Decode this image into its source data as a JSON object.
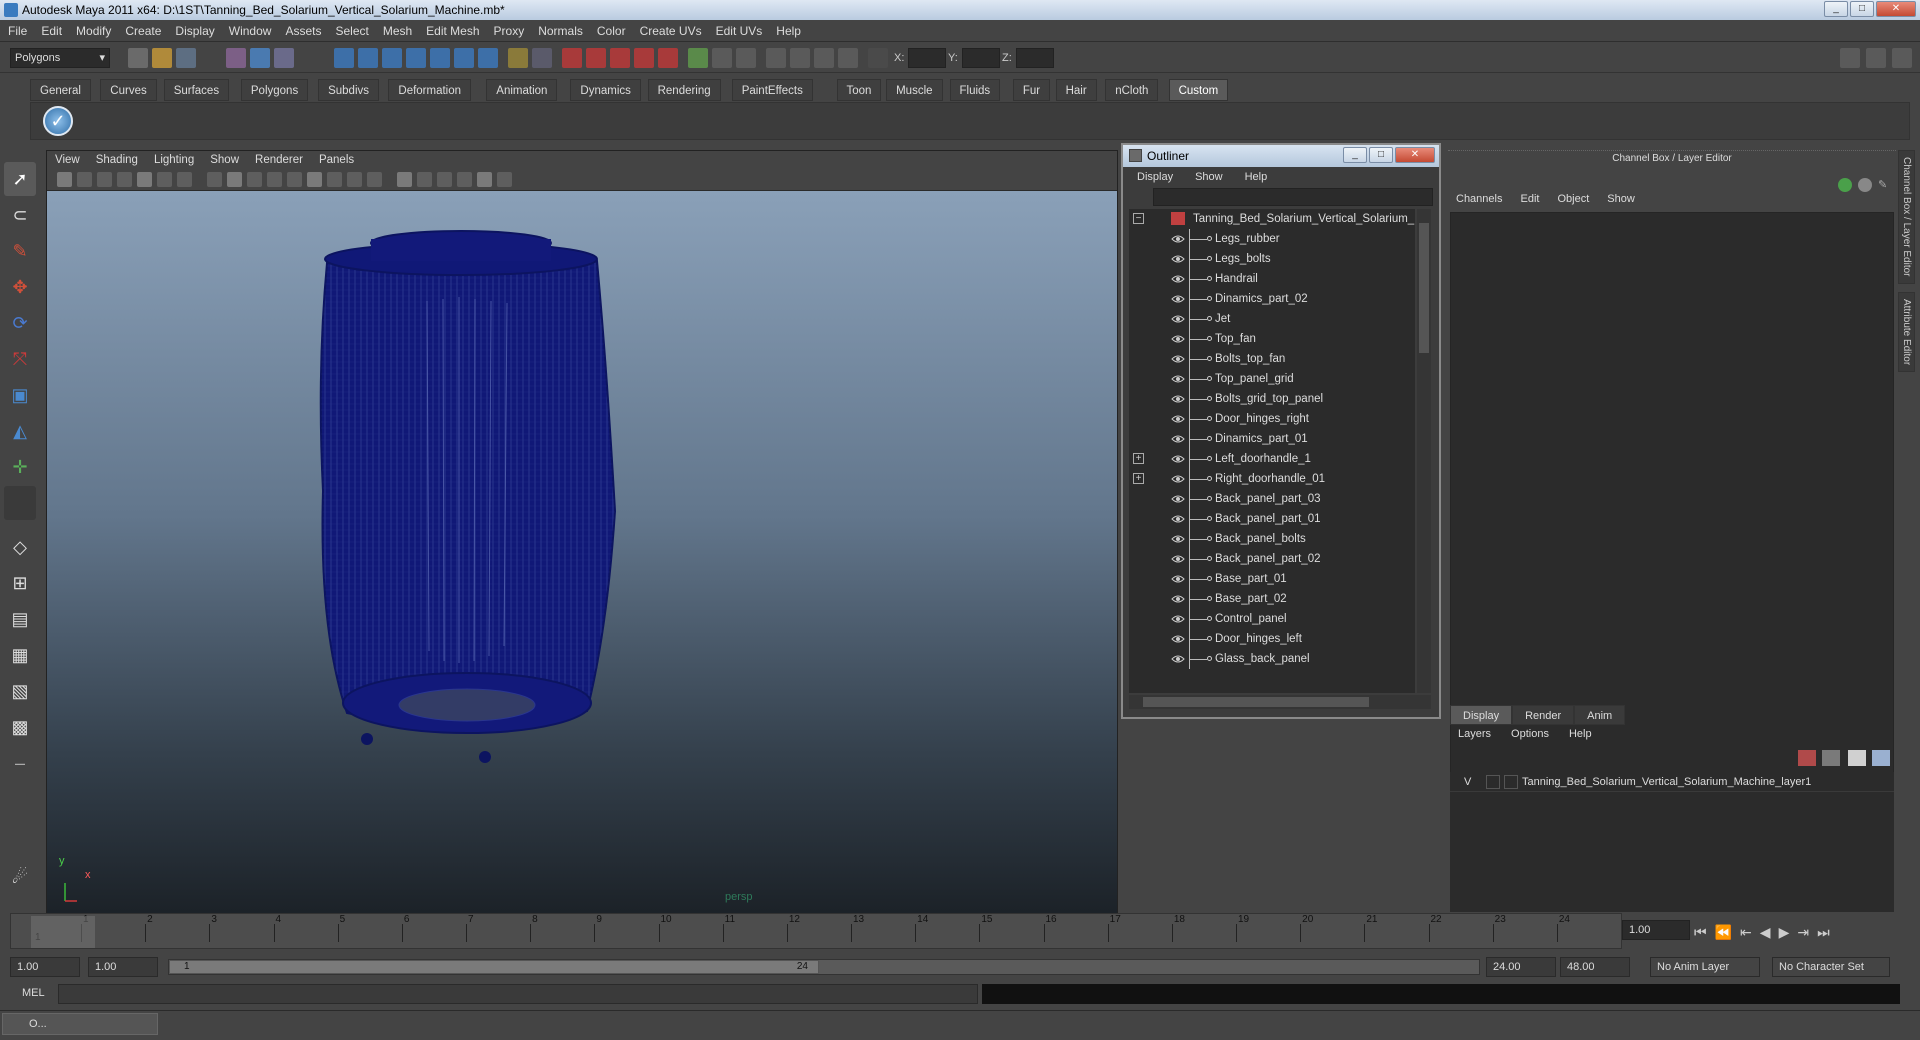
{
  "window": {
    "title": "Autodesk Maya 2011 x64: D:\\1ST\\Tanning_Bed_Solarium_Vertical_Solarium_Machine.mb*",
    "minimize": "_",
    "maximize": "□",
    "close": "✕"
  },
  "menubar": [
    "File",
    "Edit",
    "Modify",
    "Create",
    "Display",
    "Window",
    "Assets",
    "Select",
    "Mesh",
    "Edit Mesh",
    "Proxy",
    "Normals",
    "Color",
    "Create UVs",
    "Edit UVs",
    "Help"
  ],
  "status": {
    "mode": "Polygons",
    "x_label": "X:",
    "y_label": "Y:",
    "z_label": "Z:"
  },
  "shelf_tabs": [
    "General",
    "Curves",
    "Surfaces",
    "Polygons",
    "Subdivs",
    "Deformation",
    "Animation",
    "Dynamics",
    "Rendering",
    "PaintEffects",
    "Toon",
    "Muscle",
    "Fluids",
    "Fur",
    "Hair",
    "nCloth",
    "Custom"
  ],
  "shelf_active": "Custom",
  "viewport": {
    "menu": [
      "View",
      "Shading",
      "Lighting",
      "Show",
      "Renderer",
      "Panels"
    ],
    "camera_label": "persp",
    "axis_y": "y",
    "axis_x": "x"
  },
  "outliner": {
    "title": "Outliner",
    "menu": [
      "Display",
      "Show",
      "Help"
    ],
    "root": "Tanning_Bed_Solarium_Vertical_Solarium_Machine",
    "items": [
      {
        "label": "Legs_rubber",
        "expandable": false
      },
      {
        "label": "Legs_bolts",
        "expandable": false
      },
      {
        "label": "Handrail",
        "expandable": false
      },
      {
        "label": "Dinamics_part_02",
        "expandable": false
      },
      {
        "label": "Jet",
        "expandable": false
      },
      {
        "label": "Top_fan",
        "expandable": false
      },
      {
        "label": "Bolts_top_fan",
        "expandable": false
      },
      {
        "label": "Top_panel_grid",
        "expandable": false
      },
      {
        "label": "Bolts_grid_top_panel",
        "expandable": false
      },
      {
        "label": "Door_hinges_right",
        "expandable": false
      },
      {
        "label": "Dinamics_part_01",
        "expandable": false
      },
      {
        "label": "Left_doorhandle_1",
        "expandable": true
      },
      {
        "label": "Right_doorhandle_01",
        "expandable": true
      },
      {
        "label": "Back_panel_part_03",
        "expandable": false
      },
      {
        "label": "Back_panel_part_01",
        "expandable": false
      },
      {
        "label": "Back_panel_bolts",
        "expandable": false
      },
      {
        "label": "Back_panel_part_02",
        "expandable": false
      },
      {
        "label": "Base_part_01",
        "expandable": false
      },
      {
        "label": "Base_part_02",
        "expandable": false
      },
      {
        "label": "Control_panel",
        "expandable": false
      },
      {
        "label": "Door_hinges_left",
        "expandable": false
      },
      {
        "label": "Glass_back_panel",
        "expandable": false
      }
    ]
  },
  "channel_box": {
    "title": "Channel Box / Layer Editor",
    "menu": [
      "Channels",
      "Edit",
      "Object",
      "Show"
    ],
    "layer_tabs": [
      "Display",
      "Render",
      "Anim"
    ],
    "layer_tab_active": "Display",
    "layer_menu": [
      "Layers",
      "Options",
      "Help"
    ],
    "layer_visible": "V",
    "layer_name": "Tanning_Bed_Solarium_Vertical_Solarium_Machine_layer1"
  },
  "side_tabs": [
    "Channel Box / Layer Editor",
    "Attribute Editor"
  ],
  "timeline": {
    "frames": [
      1,
      2,
      3,
      4,
      5,
      6,
      7,
      8,
      9,
      10,
      11,
      12,
      13,
      14,
      15,
      16,
      17,
      18,
      19,
      20,
      21,
      22,
      23,
      24
    ],
    "current_marker": "1",
    "current_frame": "1.00"
  },
  "range": {
    "start": "1.00",
    "anim_start": "1.00",
    "slider_start": "1",
    "slider_end": "24",
    "anim_end": "24.00",
    "end": "48.00",
    "anim_layer": "No Anim Layer",
    "character_set": "No Character Set"
  },
  "command_line": {
    "label": "MEL"
  },
  "taskbar": {
    "label": "O..."
  },
  "colors": {
    "wireframe": "#101877",
    "bg_top": "#8aa0b8",
    "bg_bottom": "#1c2228",
    "panel": "#444444"
  }
}
